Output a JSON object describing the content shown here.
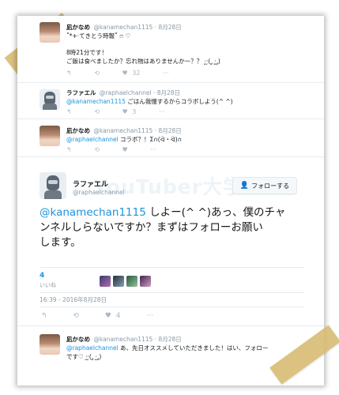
{
  "tweet1": {
    "name": "凪かなめ",
    "handle": "@kanamechan1115",
    "date": "· 8月28日",
    "line1": "˚*+‧てきとう時報˚ ෆ ♡",
    "line2": "8時21分です！",
    "line3": "ご飯は食べましたか？忘れ物はありませんかー？？ ·͈·̮( ̨̡ ‧̫ ̨̡)",
    "retweet_icon": "retweet-icon",
    "likes": "32"
  },
  "tweet2": {
    "name": "ラファエル",
    "handle": "@raphaelchannel",
    "date": "· 8月28日",
    "mention": "@kanamechan1115",
    "text": " ごはん我慢するからコラボしよう(^ ^)",
    "likes": "3"
  },
  "tweet3": {
    "name": "凪かなめ",
    "handle": "@kanamechan1115",
    "date": "· 8月28日",
    "mention": "@raphaelchannel",
    "text": " コラボ？！Σ∩(ᐛ・ᐛ)∩"
  },
  "main": {
    "name": "ラファエル",
    "handle": "@raphaelchannel",
    "follow_label": "フォローする",
    "mention": "@kanamechan1115",
    "text_a": " しよー(^ ^)あっ、僕のチャ",
    "text_b": "ンネルしらないですか？まずはフォローお願い",
    "text_c": "します。",
    "likes_count": "4",
    "likes_label": "いいね",
    "timestamp": "16:39 - 2016年8月28日",
    "action_likes": "4"
  },
  "tweet4": {
    "name": "凪かなめ",
    "handle": "@kanamechan1115",
    "date": "· 8月28日",
    "mention": "@raphaelchannel",
    "text_a": " あ、先日オススメしていただきました！はい、フォロー",
    "text_b": "です♡ ·͈·̮( ̨̡ ‧̫ ̨̡)"
  },
  "watermark": "YouTuber大学",
  "icons": {
    "reply": "↰",
    "retweet": "⟲",
    "like": "♥",
    "more": "···",
    "follow": "👤"
  }
}
